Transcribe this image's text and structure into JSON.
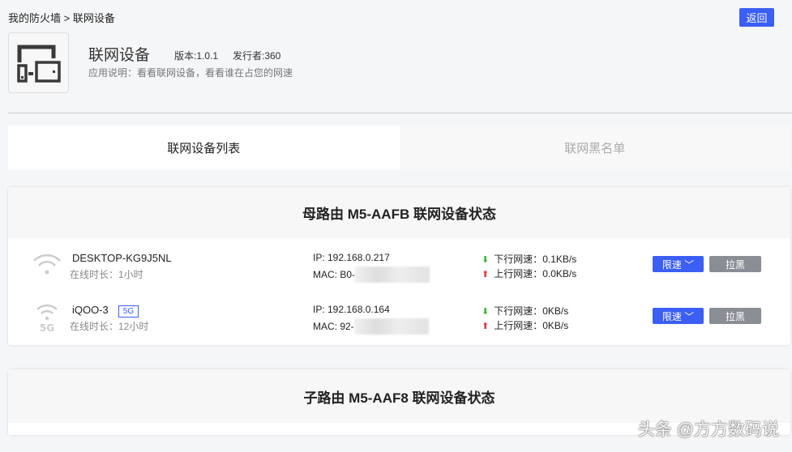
{
  "breadcrumb": "我的防火墙 > 联网设备",
  "back_label": "返回",
  "app": {
    "title": "联网设备",
    "version": "版本:1.0.1",
    "publisher": "发行者:360",
    "description": "应用说明：看看联网设备，看看谁在占您的网速"
  },
  "tabs": [
    {
      "label": "联网设备列表"
    },
    {
      "label": "联网黑名单"
    }
  ],
  "routers": [
    {
      "title": "母路由 M5-AAFB 联网设备状态",
      "devices": [
        {
          "name": "DESKTOP-KG9J5NL",
          "badge": null,
          "online": "在线时长：1小时",
          "ip": "IP: 192.168.0.217",
          "mac": "MAC: B0-",
          "down": "下行网速：0.1KB/s",
          "up": "上行网速：0.0KB/s",
          "limit": "限速",
          "block": "拉黑"
        },
        {
          "name": "iQOO-3",
          "badge": "5G",
          "online": "在线时长：12小时",
          "ip": "IP: 192.168.0.164",
          "mac": "MAC: 92-",
          "down": "下行网速：0KB/s",
          "up": "上行网速：0KB/s",
          "limit": "限速",
          "block": "拉黑"
        }
      ]
    },
    {
      "title": "子路由 M5-AAF8 联网设备状态"
    }
  ],
  "watermark": "头条 @方方数码说"
}
